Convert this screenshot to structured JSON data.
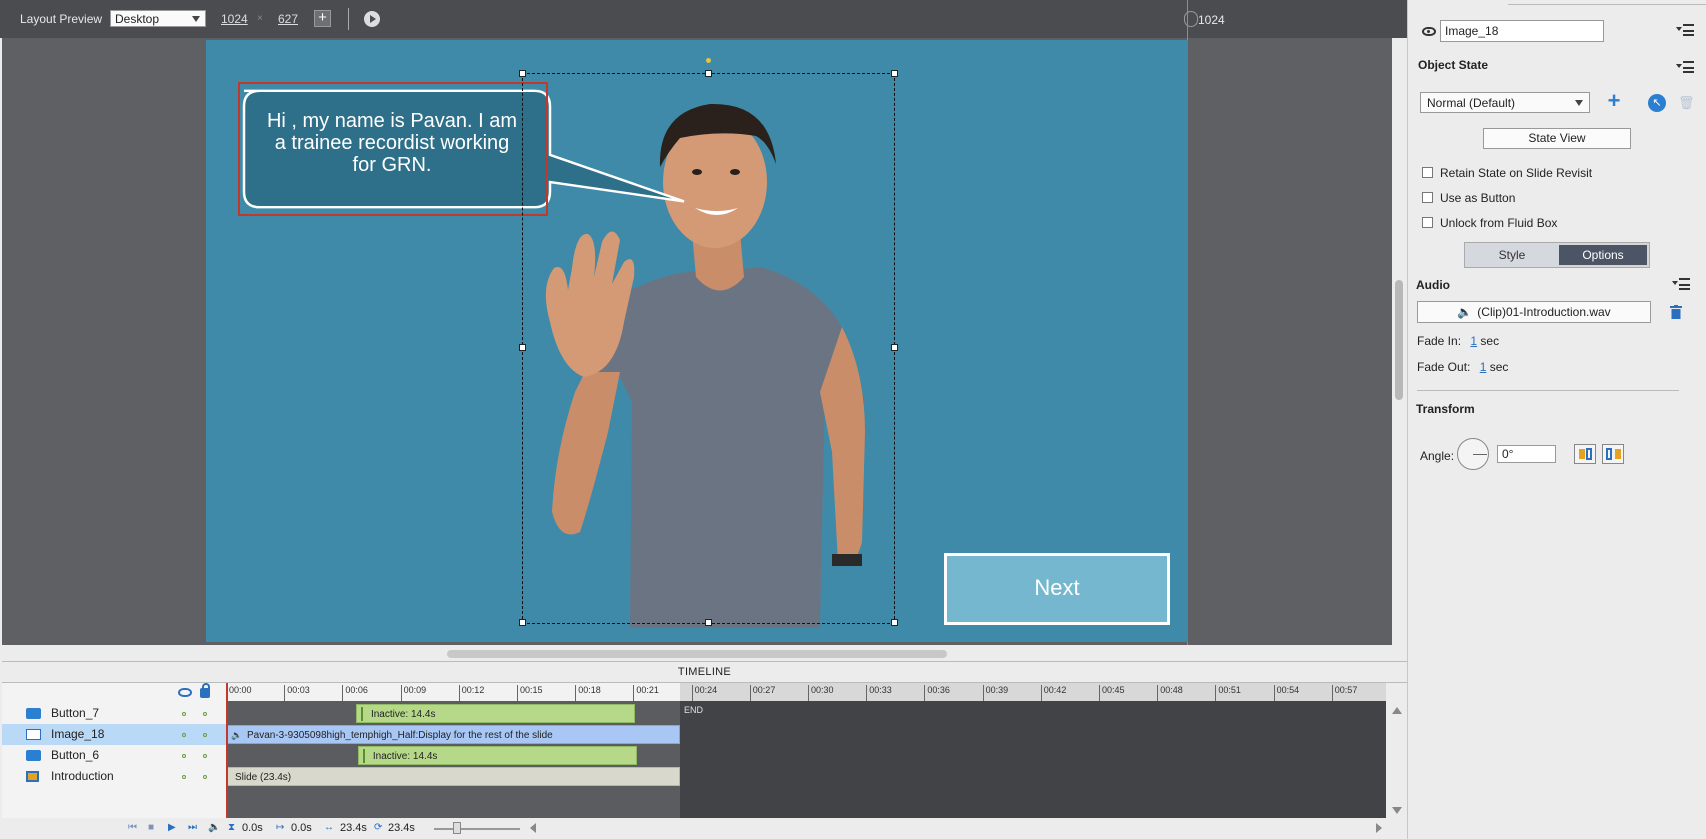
{
  "toolbar": {
    "layout_preview_label": "Layout Preview",
    "device_selected": "Desktop",
    "width": "1024",
    "times": "×",
    "height": "627",
    "breakpoint_value": "1024"
  },
  "slide": {
    "callout_text": "Hi , my name is Pavan. I am a  trainee recordist working for GRN.",
    "next_label": "Next",
    "background_color": "#3f8aa8"
  },
  "properties": {
    "object_name": "Image_18",
    "object_state_title": "Object State",
    "state_selected": "Normal (Default)",
    "state_view_label": "State View",
    "checkboxes": [
      {
        "label": "Retain State on Slide Revisit",
        "checked": false
      },
      {
        "label": "Use as Button",
        "checked": false
      },
      {
        "label": "Unlock from Fluid Box",
        "checked": false
      }
    ],
    "tabs": {
      "style": "Style",
      "options": "Options",
      "active": "Options"
    },
    "audio_title": "Audio",
    "audio_file": "(Clip)01-Introduction.wav",
    "fade_in_label": "Fade In:",
    "fade_in_value": "1",
    "fade_out_label": "Fade Out:",
    "fade_out_value": "1",
    "sec_unit": "sec",
    "transform_title": "Transform",
    "angle_label": "Angle:",
    "angle_value": "0°"
  },
  "timeline": {
    "title": "TIMELINE",
    "ticks": [
      "00:00",
      "00:03",
      "00:06",
      "00:09",
      "00:12",
      "00:15",
      "00:18",
      "00:21",
      "00:24",
      "00:27",
      "00:30",
      "00:33",
      "00:36",
      "00:39",
      "00:42",
      "00:45",
      "00:48",
      "00:51",
      "00:54",
      "00:57"
    ],
    "layers": [
      {
        "name": "Button_7",
        "icon": "button-icon",
        "bar_label": "Inactive: 14.4s",
        "bar_type": "green",
        "start_s": 6.7,
        "end_s": 21.1
      },
      {
        "name": "Image_18",
        "icon": "image-icon",
        "bar_label": "Pavan-3-9305098high_temphigh_Half:Display for the rest of the slide",
        "bar_type": "blue",
        "start_s": 0,
        "end_s": 23.4,
        "selected": true
      },
      {
        "name": "Button_6",
        "icon": "button-icon",
        "bar_label": "Inactive: 14.4s",
        "bar_type": "green",
        "start_s": 6.8,
        "end_s": 21.2
      },
      {
        "name": "Introduction",
        "icon": "slide-icon",
        "bar_label": "Slide (23.4s)",
        "bar_type": "gray",
        "start_s": 0,
        "end_s": 23.4
      }
    ],
    "end_label": "END",
    "slide_duration_s": 23.4,
    "footer": {
      "current_time": "0.0s",
      "start_time": "0.0s",
      "duration": "23.4s",
      "end_time": "23.4s"
    }
  },
  "colors": {
    "accent_blue": "#2b7fd0",
    "selection_red": "#c0392b",
    "green_bar": "#b5d889"
  }
}
